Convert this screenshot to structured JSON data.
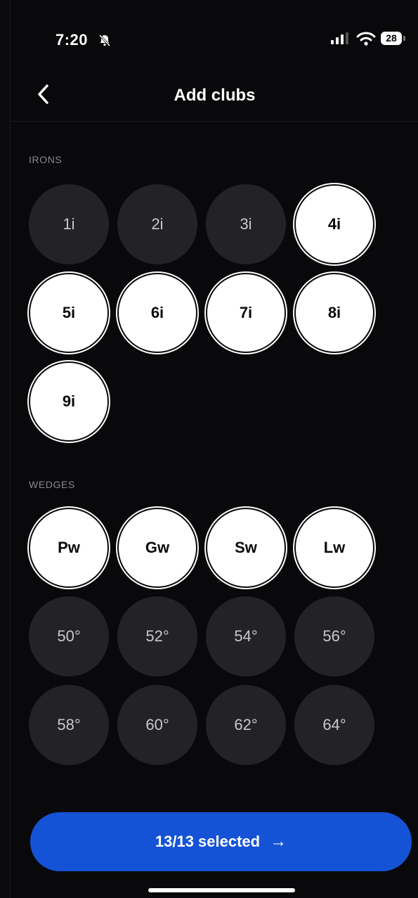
{
  "status_bar": {
    "time": "7:20",
    "battery": "28"
  },
  "header": {
    "title": "Add clubs"
  },
  "irons": {
    "label": "IRONS",
    "clubs": [
      {
        "label": "1i",
        "selected": false
      },
      {
        "label": "2i",
        "selected": false
      },
      {
        "label": "3i",
        "selected": false
      },
      {
        "label": "4i",
        "selected": true
      },
      {
        "label": "5i",
        "selected": true
      },
      {
        "label": "6i",
        "selected": true
      },
      {
        "label": "7i",
        "selected": true
      },
      {
        "label": "8i",
        "selected": true
      },
      {
        "label": "9i",
        "selected": true
      }
    ]
  },
  "wedges": {
    "label": "WEDGES",
    "clubs": [
      {
        "label": "Pw",
        "selected": true
      },
      {
        "label": "Gw",
        "selected": true
      },
      {
        "label": "Sw",
        "selected": true
      },
      {
        "label": "Lw",
        "selected": true
      },
      {
        "label": "50°",
        "selected": false
      },
      {
        "label": "52°",
        "selected": false
      },
      {
        "label": "54°",
        "selected": false
      },
      {
        "label": "56°",
        "selected": false
      },
      {
        "label": "58°",
        "selected": false
      },
      {
        "label": "60°",
        "selected": false
      },
      {
        "label": "62°",
        "selected": false
      },
      {
        "label": "64°",
        "selected": false
      }
    ]
  },
  "footer": {
    "cta_label": "13/13 selected",
    "cta_icon": "arrow-right-icon"
  },
  "colors": {
    "accent": "#1553d6",
    "selected_bg": "#ffffff",
    "unselected_bg": "#232326",
    "background": "#09090b"
  }
}
